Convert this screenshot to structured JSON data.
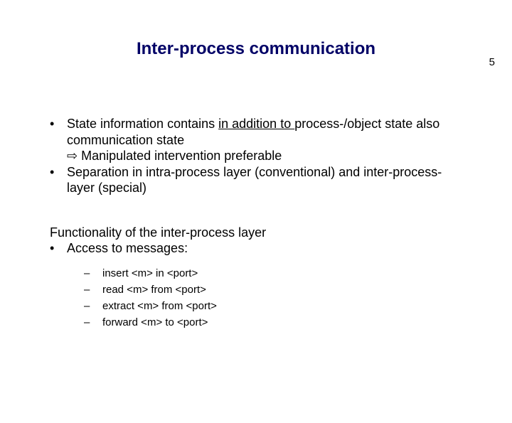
{
  "page_number": "5",
  "title": "Inter-process communication",
  "bullets": {
    "b1_pre": "State information contains ",
    "b1_underlined": "in addition to ",
    "b1_post": "process-/object state also communication state",
    "b1_arrow": "⇨",
    "b1_consequence": " Manipulated intervention preferable",
    "b2": "Separation in intra-process layer (conventional) and inter-process-layer (special)"
  },
  "section2_heading": "Functionality of the inter-process layer",
  "section2_bullet": "Access to messages:",
  "sub_items": {
    "s1": "insert <m> in <port>",
    "s2": "read <m> from <port>",
    "s3": "extract <m> from <port>",
    "s4": "forward <m> to <port>"
  },
  "glyphs": {
    "dot": "•",
    "dash": "–"
  }
}
